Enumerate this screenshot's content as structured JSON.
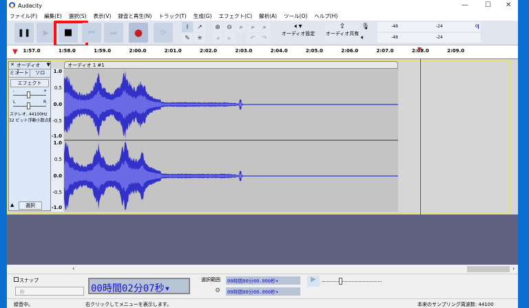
{
  "window": {
    "title": "Audacity",
    "minimize": "—",
    "maximize": "☐",
    "close": "✕"
  },
  "menu": [
    "ファイル(F)",
    "編集(E)",
    "選択(S)",
    "表示(V)",
    "録音と再生(N)",
    "トラック(T)",
    "生成(G)",
    "エフェクト(C)",
    "解析(A)",
    "ツール(O)",
    "ヘルプ(H)"
  ],
  "toolbar": {
    "pause": "❚❚",
    "play": "▶",
    "stop": "■",
    "skip_start": "⏮",
    "skip_end": "⏭",
    "record": "●",
    "loop": "⟳",
    "audio_setup": "オーディオ設定",
    "share_audio": "オーディオ共有",
    "meter_rec": [
      "-48",
      "-24",
      "0"
    ],
    "meter_play": [
      "-48",
      "-24"
    ],
    "highlight_color": "#ff0000"
  },
  "ruler": {
    "ticks": [
      "1:57.0",
      "1:58.0",
      "1:59.0",
      "2:00.0",
      "2:01.0",
      "2:02.0",
      "2:03.0",
      "2:04.0",
      "2:05.0",
      "2:06.0",
      "2:07.0",
      "2:08.0",
      "2:09.0"
    ]
  },
  "track": {
    "name": "オーディオ 1",
    "clip_name": "オーディオ 1 #1",
    "mute": "ミュート",
    "solo": "ソロ",
    "effect": "エフェクト",
    "gain_minus": "-",
    "gain_plus": "+",
    "pan_l": "L",
    "pan_r": "R",
    "info1": "ステレオ, 44100Hz",
    "info2": "32 ビット浮動小数点数",
    "select": "選択",
    "scale": [
      "1.0",
      "0.5",
      "0.0",
      "-0.5",
      "-1.0"
    ],
    "wave_color": "#3232c8"
  },
  "selection": {
    "snap": "スナップ",
    "snap_unit": "秒",
    "time": "00時間02分07秒",
    "range_label": "選択範囲",
    "start": "00時間00分00.000秒",
    "end": "00時間00分00.000秒"
  },
  "status": {
    "state": "録音中。",
    "hint": "右クリックしてメニューを表示します。",
    "rate": "本来のサンプリング周波数: 44100"
  }
}
